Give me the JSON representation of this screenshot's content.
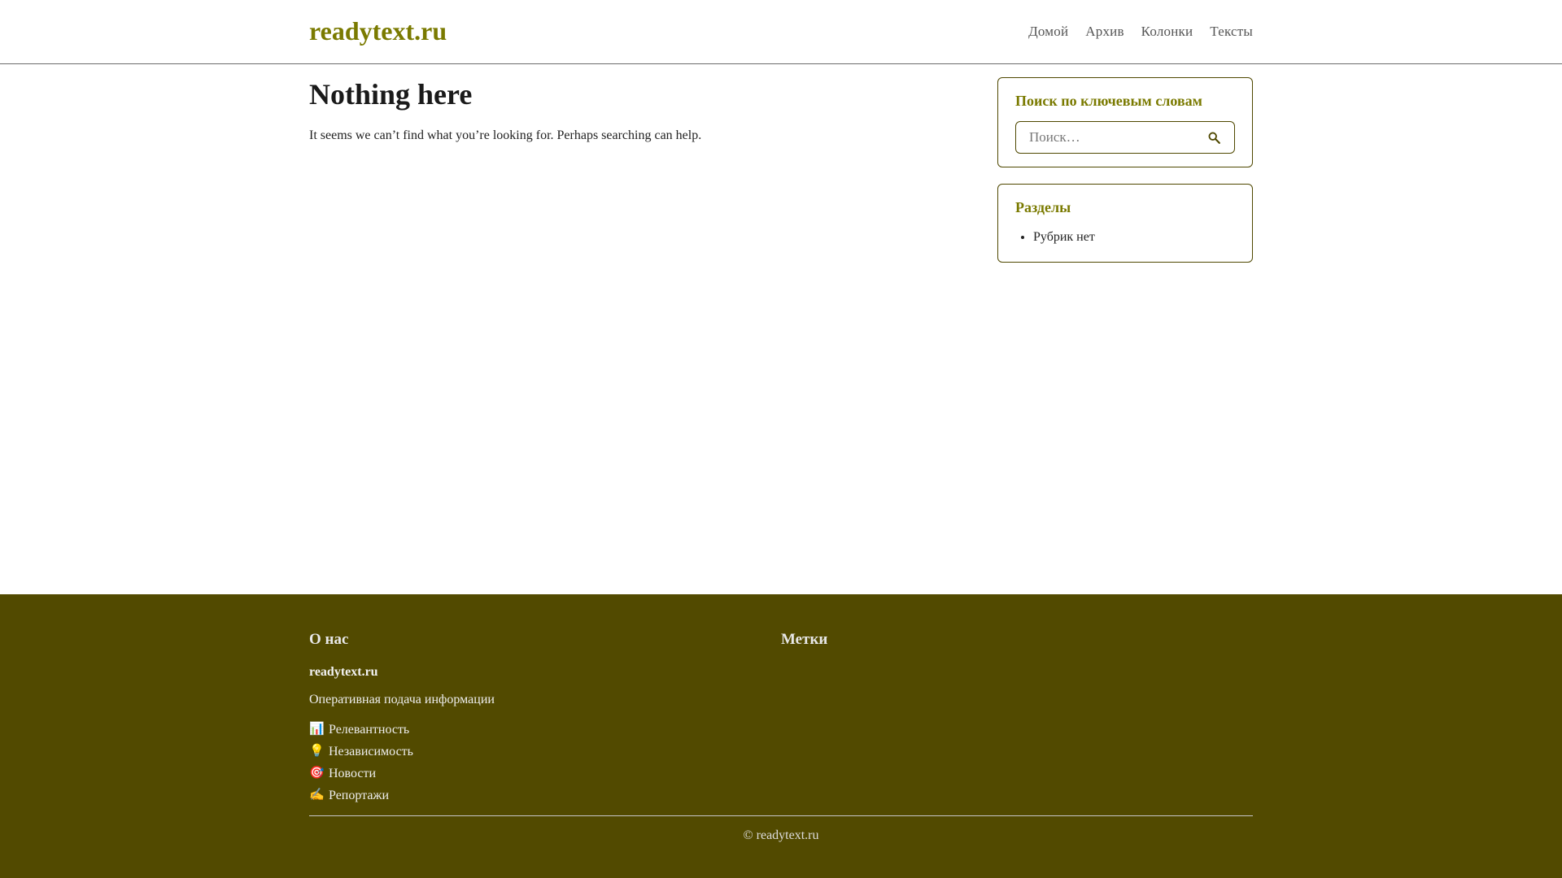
{
  "header": {
    "brand": "readytext.ru",
    "nav": [
      {
        "label": "Домой"
      },
      {
        "label": "Архив"
      },
      {
        "label": "Колонки"
      },
      {
        "label": "Тексты"
      }
    ]
  },
  "main": {
    "title": "Nothing here",
    "description": "It seems we can’t find what you’re looking for. Perhaps searching can help."
  },
  "sidebar": {
    "search_widget": {
      "title": "Поиск по ключевым словам",
      "placeholder": "Поиск…",
      "value": ""
    },
    "categories_widget": {
      "title": "Разделы",
      "items": [
        {
          "label": "Рубрик нет"
        }
      ]
    }
  },
  "footer": {
    "about": {
      "heading": "О нас",
      "name": "readytext.ru",
      "tagline": "Оперативная подача информации",
      "features": [
        {
          "icon": "📊",
          "label": "Релевантность"
        },
        {
          "icon": "💡",
          "label": "Независимость"
        },
        {
          "icon": "🎯",
          "label": "Новости"
        },
        {
          "icon": "✍",
          "label": "Репортажи"
        }
      ]
    },
    "tags": {
      "heading": "Метки"
    },
    "copyright": "© readytext.ru"
  },
  "colors": {
    "accent": "#7a7a00",
    "footer_bg": "#524a00",
    "border": "#4f4800"
  }
}
